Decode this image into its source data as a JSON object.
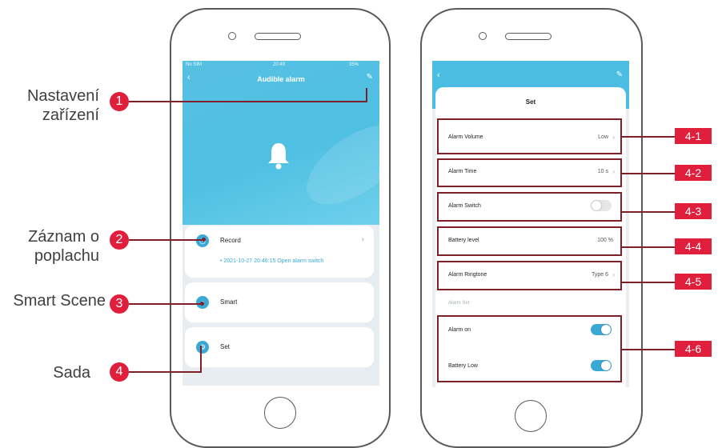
{
  "left_screen": {
    "status": {
      "carrier": "No SIM",
      "time": "20:49",
      "battery": "35%"
    },
    "nav": {
      "back": "‹",
      "title": "Audible alarm",
      "edit": "✎"
    },
    "cards": [
      {
        "label": "Record",
        "sub": "• 2021-10-27 20:46:15 Open alarm switch",
        "chev": "›"
      },
      {
        "label": "Smart"
      },
      {
        "label": "Set"
      }
    ]
  },
  "right_screen": {
    "nav": {
      "back": "‹",
      "edit": "✎"
    },
    "title": "Set",
    "rows": [
      {
        "label": "Alarm Volume",
        "value": "Low",
        "chev": "›"
      },
      {
        "label": "Alarm Time",
        "value": "10 s",
        "chev": "›"
      },
      {
        "label": "Alarm Switch",
        "toggle": false
      },
      {
        "label": "Battery level",
        "value": "100 %"
      },
      {
        "label": "Alarm Ringtone",
        "value": "Type 6",
        "chev": "›"
      }
    ],
    "section": "Alarm Set",
    "alarm_rows": [
      {
        "label": "Alarm on",
        "toggle": true
      },
      {
        "label": "Battery Low",
        "toggle": true
      }
    ]
  },
  "callouts": {
    "left": [
      {
        "num": "1",
        "label": "Nastavení zařízení"
      },
      {
        "num": "2",
        "label": "Záznam o poplachu"
      },
      {
        "num": "3",
        "label": "Smart Scene"
      },
      {
        "num": "4",
        "label": "Sada"
      }
    ],
    "right": [
      "4-1",
      "4-2",
      "4-3",
      "4-4",
      "4-5",
      "4-6"
    ]
  },
  "colors": {
    "accent": "#e01f3d",
    "frame": "#7f1f2a",
    "app_blue": "#4cbde2"
  }
}
